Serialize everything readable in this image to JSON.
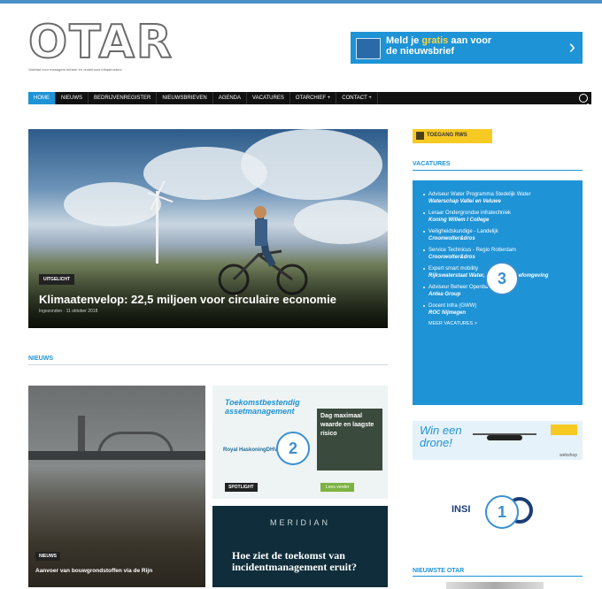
{
  "logo": {
    "text": "OTAR",
    "tagline": "Vakblad voor managers beheer en onderhoud infrastructuur"
  },
  "newsletter": {
    "line1_pre": "Meld je ",
    "line1_hl": "gratis",
    "line1_post": " aan voor",
    "line2": "de nieuwsbrief"
  },
  "nav": {
    "items": [
      "HOME",
      "NIEUWS",
      "BEDRIJVENREGISTER",
      "NIEUWSBRIEVEN",
      "AGENDA",
      "VACATURES",
      "OTARCHIEF +",
      "CONTACT +"
    ]
  },
  "hero": {
    "category": "UITGELICHT",
    "title": "Klimaatenvelop: 22,5 miljoen voor circulaire economie",
    "meta": "Ingezonden  ·  11 oktober 2018"
  },
  "news": {
    "heading": "NIEUWS",
    "left": {
      "category": "NIEUWS",
      "title": "Aanvoer van bouwgrondstoffen via de Rijn"
    },
    "right_top": {
      "headline": "Toekomstbestendig\nassetmanagement",
      "panel": "Dag maximaal waarde en laagste risico",
      "logo": "Royal HaskoningDHV",
      "category": "SPOTLIGHT",
      "button": "Lees verder"
    },
    "right_bottom": {
      "brand": "MERIDIAN",
      "headline": "Hoe ziet de toekomst van incidentmanagement eruit?"
    }
  },
  "sidebar": {
    "toegang": "TOEGANG RWS",
    "vacatures_heading": "VACATURES",
    "vacatures": [
      {
        "title": "Adviseur Water Programma Stedelijk Water",
        "org": "Waterschap Vallei en Veluwe"
      },
      {
        "title": "Leraar Ondergrondse infratechniek",
        "org": "Koning Willem I College"
      },
      {
        "title": "Veiligheidskundige - Landelijk",
        "org": "Croonwolter&dros"
      },
      {
        "title": "Service Technicus - Regio Rotterdam",
        "org": "Croonwolter&dros"
      },
      {
        "title": "Expert smart mobility",
        "org": "Rijkswaterstaat Water, Verkeer & Leefomgeving"
      },
      {
        "title": "Adviseur Beheer Openbare Ruimte",
        "org": "Antea Group"
      },
      {
        "title": "Docent Infra (GWW)",
        "org": "ROC Nijmegen"
      }
    ],
    "vacatures_more": "MEER VACATURES >",
    "drone": {
      "text": "Win een\ndrone!",
      "footer": "webshop"
    },
    "insite": "INSI",
    "otar_heading": "NIEUWSTE OTAR"
  },
  "badges": [
    "1",
    "2",
    "3"
  ],
  "colors": {
    "accent": "#1e93d6",
    "nav_bg": "#111111",
    "toegang": "#f7c923"
  }
}
